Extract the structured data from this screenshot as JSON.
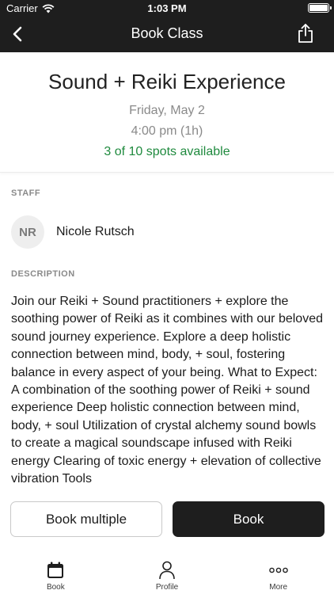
{
  "status_bar": {
    "carrier": "Carrier",
    "time": "1:03 PM"
  },
  "nav": {
    "title": "Book Class",
    "back_icon": "chevron-left-icon",
    "share_icon": "share-icon"
  },
  "class_info": {
    "title": "Sound + Reiki Experience",
    "date": "Friday, May 2",
    "time": "4:00 pm (1h)",
    "spots": "3 of 10 spots available"
  },
  "staff": {
    "section_label": "STAFF",
    "initials": "NR",
    "name": "Nicole Rutsch"
  },
  "description": {
    "section_label": "DESCRIPTION",
    "text": "Join our Reiki + Sound practitioners + explore the soothing power of Reiki as it combines with our beloved sound journey experience.   Explore a deep holistic connection between mind, body, + soul, fostering balance in every aspect of your being. What to Expect: A combination of the soothing power of Reiki + sound experience Deep holistic connection between mind, body, + soul Utilization of crystal alchemy sound bowls to create a magical soundscape infused with Reiki energy Clearing of toxic energy + elevation of collective vibration   Tools"
  },
  "actions": {
    "book_multiple": "Book multiple",
    "book": "Book"
  },
  "tabs": [
    {
      "label": "Book",
      "icon": "calendar-icon"
    },
    {
      "label": "Profile",
      "icon": "person-icon"
    },
    {
      "label": "More",
      "icon": "more-icon"
    }
  ],
  "colors": {
    "nav_background": "#1e1e1e",
    "spots_available": "#1f8a3e",
    "primary_button": "#1e1e1e"
  }
}
